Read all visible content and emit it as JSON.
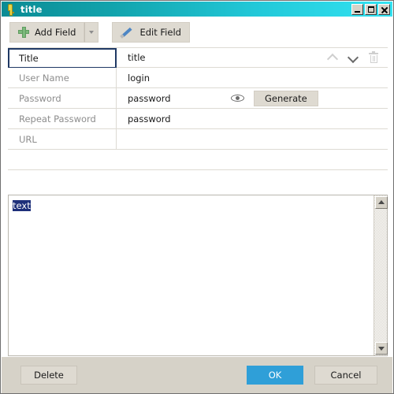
{
  "window": {
    "title": "title",
    "icon": "key-icon",
    "controls": {
      "minimize": "Minimize",
      "maximize": "Maximize",
      "close": "Close"
    },
    "gradient_start": "#0b8b94",
    "gradient_end": "#33e3f2"
  },
  "toolbar": {
    "add_field_label": "Add Field",
    "add_field_icon": "plus-icon",
    "add_field_dropdown": "More field types",
    "edit_field_label": "Edit Field",
    "edit_field_icon": "pencil-icon"
  },
  "fields": {
    "rows": [
      {
        "label": "Title",
        "value": "title",
        "selected": true,
        "has_actions": true,
        "has_generate": false
      },
      {
        "label": "User Name",
        "value": "login",
        "selected": false,
        "has_actions": false,
        "has_generate": false
      },
      {
        "label": "Password",
        "value": "password",
        "selected": false,
        "has_actions": false,
        "has_generate": true
      },
      {
        "label": "Repeat Password",
        "value": "password",
        "selected": false,
        "has_actions": false,
        "has_generate": false
      },
      {
        "label": "URL",
        "value": "",
        "selected": false,
        "has_actions": false,
        "has_generate": false
      }
    ],
    "actions": {
      "move_up": "move-up",
      "move_down": "move-down",
      "delete_field": "delete-field"
    },
    "reveal_password_icon": "eye-icon",
    "generate_label": "Generate"
  },
  "notes": {
    "text": "text",
    "selected": true,
    "selection_color": "#1d2f7a"
  },
  "footer": {
    "delete_label": "Delete",
    "ok_label": "OK",
    "cancel_label": "Cancel",
    "ok_color": "#2f9fd8"
  }
}
